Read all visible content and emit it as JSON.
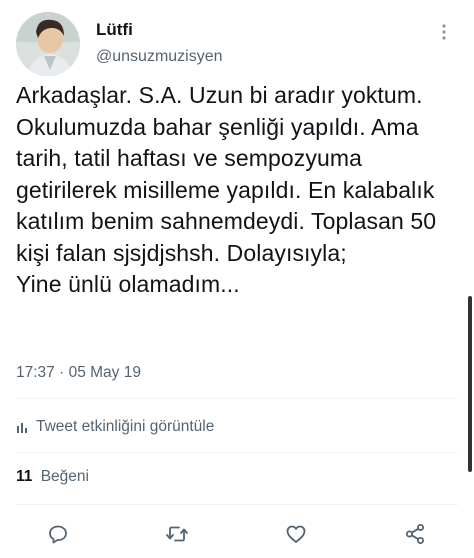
{
  "author": {
    "display_name": "Lütfi",
    "handle": "@unsuzmuzisyen"
  },
  "tweet": {
    "text": "Arkadaşlar. S.A. Uzun bi aradır yoktum. Okulumuzda bahar şenliği yapıldı. Ama tarih, tatil haftası ve sempozyuma getirilerek misilleme yapıldı. En kalabalık katılım benim sahnemdeydi. Toplasan 50 kişi falan sjsjdjshsh. Dolayısıyla;\nYine ünlü olamadım...",
    "time": "17:37",
    "separator": "·",
    "date": "05 May 19"
  },
  "analytics": {
    "label": "Tweet etkinliğini görüntüle"
  },
  "likes": {
    "count": "11",
    "label": "Beğeni"
  },
  "icons": {
    "more": "more-vertical-icon",
    "analytics": "bar-chart-icon",
    "reply": "reply-icon",
    "retweet": "retweet-icon",
    "like": "heart-icon",
    "share": "share-icon"
  },
  "colors": {
    "text_primary": "#0f1419",
    "text_secondary": "#536471",
    "divider": "#eff3f4",
    "icon": "#536471"
  }
}
